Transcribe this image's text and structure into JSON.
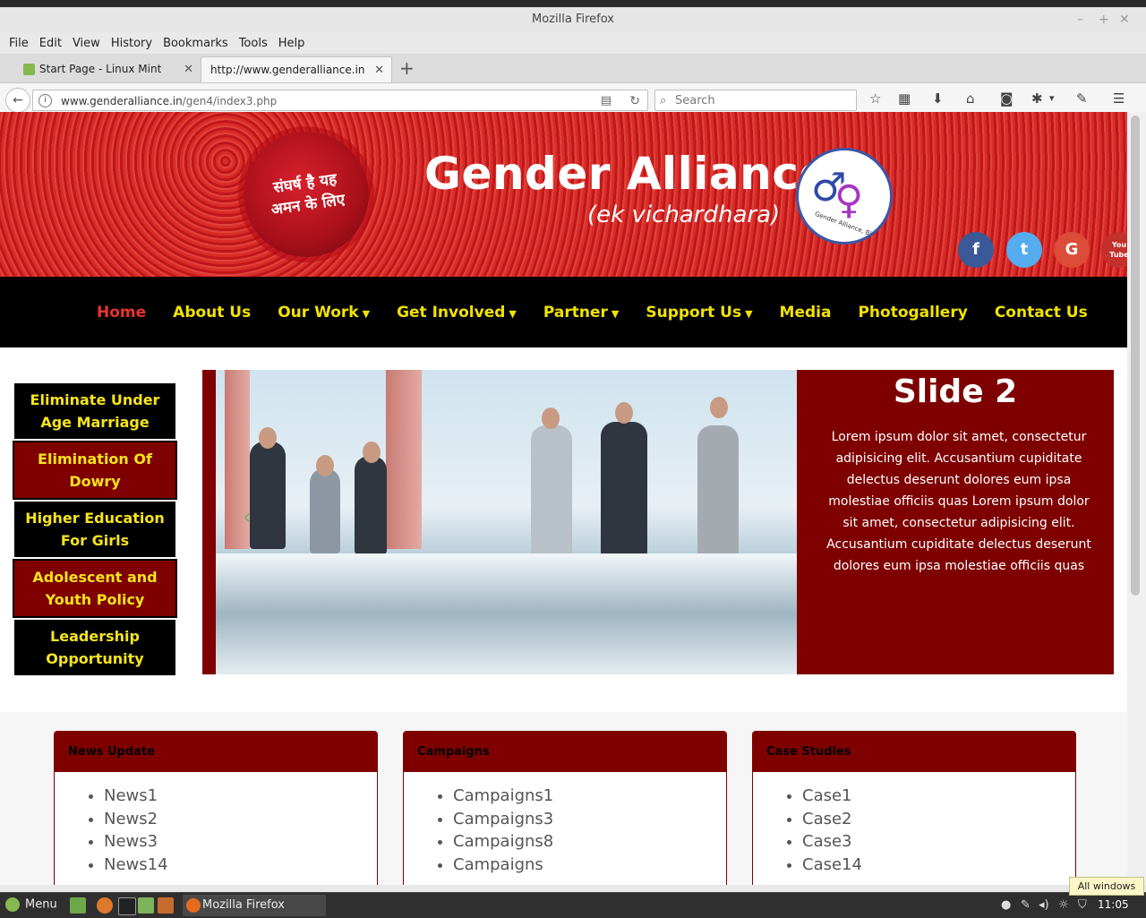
{
  "window": {
    "title": "Mozilla Firefox",
    "controls": [
      "–",
      "+",
      "✕"
    ]
  },
  "menubar": {
    "items": [
      {
        "label": "File"
      },
      {
        "label": "Edit"
      },
      {
        "label": "View"
      },
      {
        "label": "History"
      },
      {
        "label": "Bookmarks"
      },
      {
        "label": "Tools"
      },
      {
        "label": "Help"
      }
    ]
  },
  "tabs": [
    {
      "title": "Start Page - Linux Mint",
      "close": "✕"
    },
    {
      "title": "http://www.genderalliance.in/ge",
      "close": "✕"
    }
  ],
  "newtab": "+",
  "navbar": {
    "back": "←",
    "url_domain": "www.genderalliance.in",
    "url_path": "/gen4/index3.php",
    "search_placeholder": "Search"
  },
  "site": {
    "seal_text_line1": "संघर्ष है यह",
    "seal_text_line2": "अमन के लिए",
    "title": "Gender Alliance",
    "subtitle": "(ek vichardhara)",
    "logo_text": "Gender Alliance, Bihar",
    "social": [
      {
        "name": "facebook",
        "glyph": "f",
        "color": "#3b5998"
      },
      {
        "name": "twitter",
        "glyph": "t",
        "color": "#55acee"
      },
      {
        "name": "google",
        "glyph": "G",
        "color": "#dd4b39"
      },
      {
        "name": "youtube",
        "glyph": "You Tube",
        "color": "#c4302b"
      }
    ],
    "nav": [
      {
        "label": "Home",
        "active": true,
        "caret": false
      },
      {
        "label": "About Us",
        "active": false,
        "caret": false
      },
      {
        "label": "Our Work",
        "active": false,
        "caret": true
      },
      {
        "label": "Get Involved",
        "active": false,
        "caret": true
      },
      {
        "label": "Partner",
        "active": false,
        "caret": true
      },
      {
        "label": "Support Us",
        "active": false,
        "caret": true
      },
      {
        "label": "Media",
        "active": false,
        "caret": false
      },
      {
        "label": "Photogallery",
        "active": false,
        "caret": false
      },
      {
        "label": "Contact Us",
        "active": false,
        "caret": false
      }
    ],
    "sidebar": [
      {
        "label": "Eliminate Under Age Marriage"
      },
      {
        "label": "Elimination Of Dowry"
      },
      {
        "label": "Higher Education For Girls"
      },
      {
        "label": "Adolescent and Youth Policy"
      },
      {
        "label": "Leadership Opportunity"
      }
    ],
    "slide": {
      "title": "Slide 2",
      "text": "Lorem ipsum dolor sit amet, consectetur adipisicing elit. Accusantium cupiditate delectus deserunt dolores eum ipsa molestiae officiis quas Lorem ipsum dolor sit amet, consectetur adipisicing elit. Accusantium cupiditate delectus deserunt dolores eum ipsa molestiae officiis quas"
    },
    "panels": [
      {
        "title": "News Update",
        "items": [
          "News1",
          "News2",
          "News3",
          "News14"
        ]
      },
      {
        "title": "Campaigns",
        "items": [
          "Campaigns1",
          "Campaigns3",
          "Campaigns8",
          "Campaigns"
        ]
      },
      {
        "title": "Case Studies",
        "items": [
          "Case1",
          "Case2",
          "Case3",
          "Case14"
        ]
      }
    ]
  },
  "taskbar": {
    "menu_label": "Menu",
    "app_label": "Mozilla Firefox",
    "clock": "11:05",
    "tooltip": "All windows"
  }
}
